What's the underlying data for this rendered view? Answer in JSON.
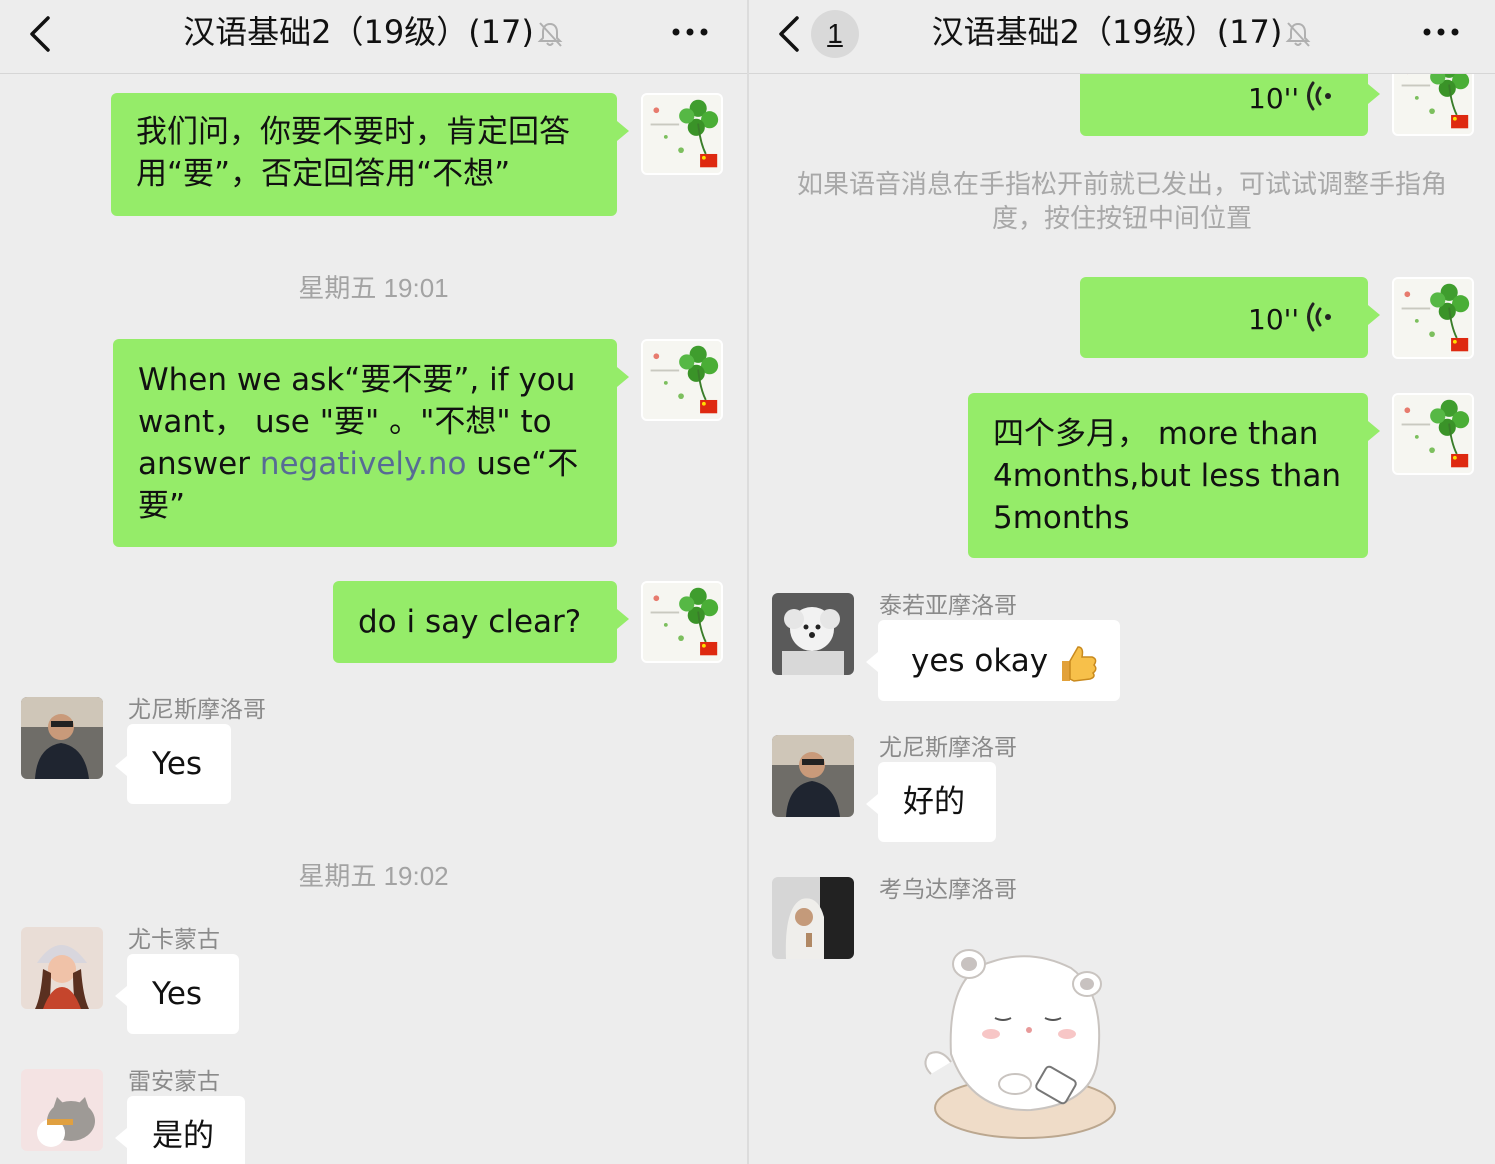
{
  "colors": {
    "my_bubble": "#95ec69",
    "other_bubble": "#ffffff",
    "background": "#ededed",
    "link": "#576b95",
    "timestamp": "#a3a3a3"
  },
  "left": {
    "header": {
      "title": "汉语基础2（19级）(17)"
    },
    "messages": [
      {
        "text": "我们问，你要不要时，肯定回答用“要”，否定回答用“不想”"
      },
      {
        "timestamp": "星期五 19:01"
      },
      {
        "part1": "When we ask“要不要”, if you want，  use \"要\" 。\"不想\" to answer ",
        "link": "negatively.no",
        "part2": " use“不要”"
      },
      {
        "text": "do i say clear?"
      },
      {
        "sender": "尤尼斯摩洛哥",
        "text": "Yes"
      },
      {
        "timestamp": "星期五 19:02"
      },
      {
        "sender": "尤卡蒙古",
        "text": "Yes"
      },
      {
        "sender": "雷安蒙古",
        "text": "是的"
      }
    ]
  },
  "right": {
    "header": {
      "title": "汉语基础2（19级）(17)",
      "unread": "1"
    },
    "messages": [
      {
        "voice_duration": "10''"
      },
      {
        "system_note": "如果语音消息在手指松开前就已发出，可试试调整手指角度，按住按钮中间位置"
      },
      {
        "voice_duration": "10''"
      },
      {
        "text": "四个多月， more than 4months,but less than 5months"
      },
      {
        "sender": "泰若亚摩洛哥",
        "text": "yes okay",
        "emoji": "thumbs-up"
      },
      {
        "sender": "尤尼斯摩洛哥",
        "text": "好的"
      },
      {
        "sender": "考乌达摩洛哥",
        "sticker": "hamster-sticker"
      }
    ]
  }
}
